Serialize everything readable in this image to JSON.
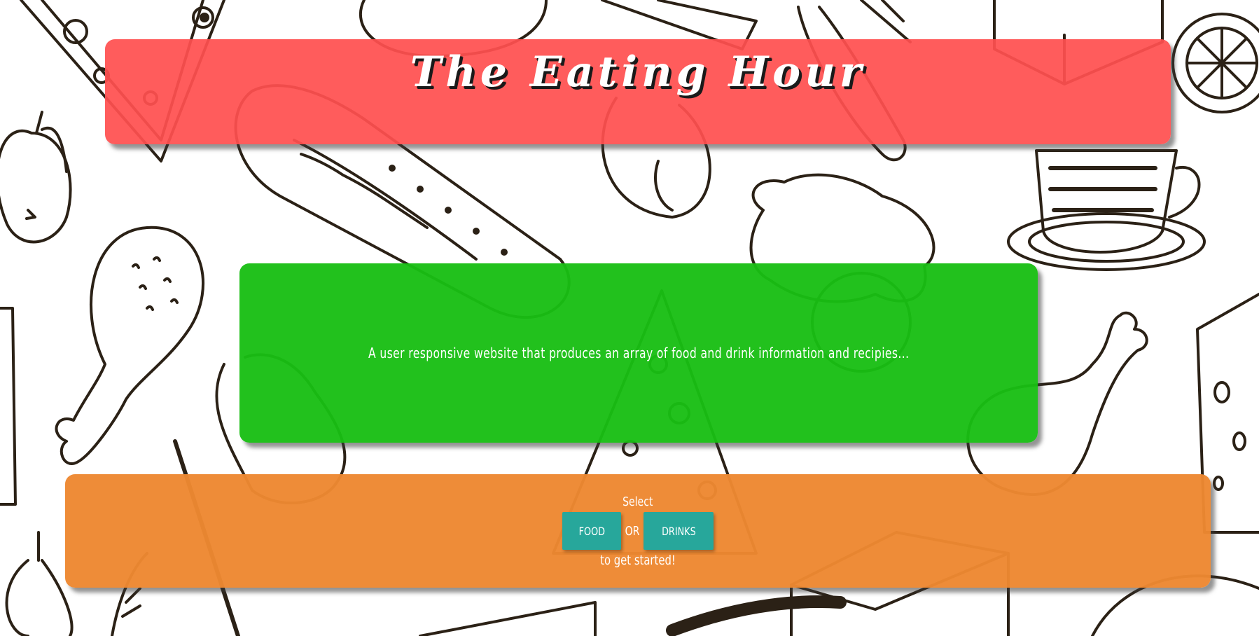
{
  "header": {
    "title": "The Eating Hour"
  },
  "about": {
    "description": "A user responsive website that produces an array of food and drink information and recipies..."
  },
  "select": {
    "prompt": "Select",
    "food_label": "FOOD",
    "or_label": "OR",
    "drinks_label": "DRINKS",
    "suffix": "to get started!"
  },
  "colors": {
    "header": "#ff5a5a",
    "about": "#1ec01a",
    "select": "#ee8a33",
    "button": "#27a79b",
    "doodle_ink": "#2b2116"
  },
  "background": {
    "icon": "food-doodle-pattern-icon"
  }
}
